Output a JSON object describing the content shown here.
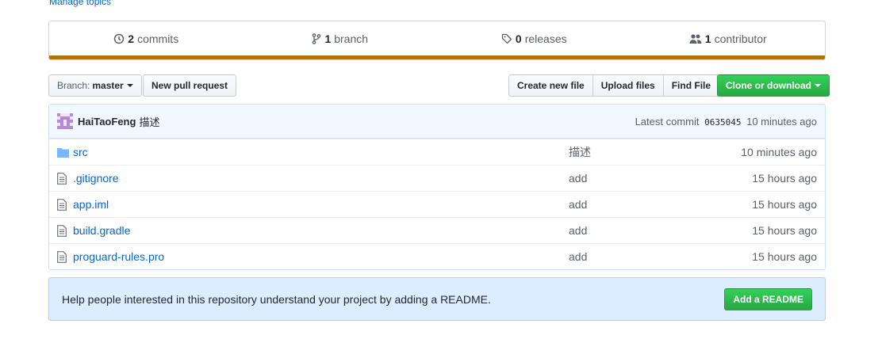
{
  "topics": {
    "manage_label": "Manage topics"
  },
  "summary": {
    "commits": {
      "count": "2",
      "label": "commits"
    },
    "branches": {
      "count": "1",
      "label": "branch"
    },
    "releases": {
      "count": "0",
      "label": "releases"
    },
    "contributors": {
      "count": "1",
      "label": "contributor"
    },
    "language_color": "#b07219"
  },
  "toolbar": {
    "branch_prefix": "Branch:",
    "branch_name": "master",
    "new_pr_label": "New pull request",
    "create_file_label": "Create new file",
    "upload_files_label": "Upload files",
    "find_file_label": "Find File",
    "clone_label": "Clone or download"
  },
  "latest_commit": {
    "author": "HaiTaoFeng",
    "message": "描述",
    "prefix": "Latest commit",
    "sha": "0635045",
    "age": "10 minutes ago"
  },
  "files": [
    {
      "type": "dir",
      "name": "src",
      "message": "描述",
      "age": "10 minutes ago"
    },
    {
      "type": "file",
      "name": ".gitignore",
      "message": "add",
      "age": "15 hours ago"
    },
    {
      "type": "file",
      "name": "app.iml",
      "message": "add",
      "age": "15 hours ago"
    },
    {
      "type": "file",
      "name": "build.gradle",
      "message": "add",
      "age": "15 hours ago"
    },
    {
      "type": "file",
      "name": "proguard-rules.pro",
      "message": "add",
      "age": "15 hours ago"
    }
  ],
  "readme": {
    "prompt": "Help people interested in this repository understand your project by adding a README.",
    "button_label": "Add a README"
  },
  "colors": {
    "link": "#0366d6",
    "primary_button": "#28a745",
    "banner_bg": "#dbedff"
  }
}
